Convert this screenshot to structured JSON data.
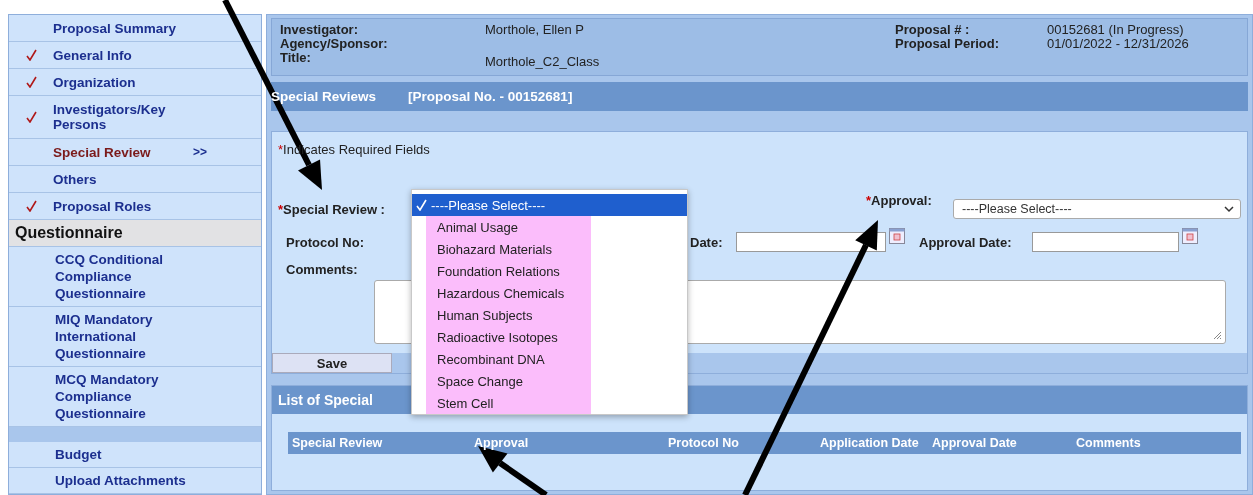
{
  "sidebar": {
    "items": [
      {
        "kind": "item",
        "label": "Proposal Summary",
        "checked": false,
        "selected": false
      },
      {
        "kind": "item",
        "label": "General Info",
        "checked": true,
        "selected": false
      },
      {
        "kind": "item",
        "label": "Organization",
        "checked": true,
        "selected": false
      },
      {
        "kind": "item",
        "label": "Investigators/Key Persons",
        "checked": true,
        "selected": false
      },
      {
        "kind": "item",
        "label": "Special Review",
        "checked": false,
        "selected": true,
        "marker": ">>"
      },
      {
        "kind": "item",
        "label": "Others",
        "checked": false,
        "selected": false
      },
      {
        "kind": "item",
        "label": "Proposal Roles",
        "checked": true,
        "selected": false
      },
      {
        "kind": "heading",
        "label": "Questionnaire"
      },
      {
        "kind": "sub",
        "label": "CCQ Conditional Compliance Questionnaire",
        "selected": false
      },
      {
        "kind": "sub",
        "label": "MIQ Mandatory International Questionnaire",
        "selected": false
      },
      {
        "kind": "sub",
        "label": "MCQ Mandatory Compliance Questionnaire",
        "selected": false
      },
      {
        "kind": "spacer"
      },
      {
        "kind": "sub",
        "label": "Budget",
        "selected": false
      },
      {
        "kind": "sub",
        "label": "Upload Attachments",
        "selected": false
      }
    ]
  },
  "header": {
    "left": [
      {
        "label": "Investigator:",
        "value": "Morthole, Ellen P"
      },
      {
        "label": "Agency/Sponsor:"
      },
      {
        "label": "Title:",
        "value": "Morthole_C2_Class"
      }
    ],
    "right": [
      {
        "label": "Proposal # :",
        "value": "00152681 (In Progress)"
      },
      {
        "label": "Proposal Period:",
        "value": "01/01/2022 - 12/31/2026"
      }
    ]
  },
  "section": {
    "title": "Special Reviews",
    "reference": "[Proposal No. - 00152681]"
  },
  "form": {
    "required_note_mark": "*",
    "required_note": "Indicates Required Fields",
    "special_review": {
      "label": "Special Review :",
      "required_mark": "*"
    },
    "approval": {
      "label": "Approval:",
      "required_mark": "*",
      "value": "----Please Select----"
    },
    "protocol_no": {
      "label": "Protocol No:"
    },
    "application_date": {
      "label": "Date:"
    },
    "approval_date": {
      "label": "Approval Date:"
    },
    "comments": {
      "label": "Comments:"
    },
    "save_button": "Save"
  },
  "dropdown": {
    "options": [
      {
        "label": "----Please Select----",
        "selected": true
      },
      {
        "label": "Animal Usage",
        "selected": false
      },
      {
        "label": "Biohazard Materials",
        "selected": false
      },
      {
        "label": "Foundation Relations",
        "selected": false
      },
      {
        "label": "Hazardous Chemicals",
        "selected": false
      },
      {
        "label": "Human Subjects",
        "selected": false
      },
      {
        "label": "Radioactive Isotopes",
        "selected": false
      },
      {
        "label": "Recombinant DNA",
        "selected": false
      },
      {
        "label": "Space Change",
        "selected": false
      },
      {
        "label": "Stem Cell",
        "selected": false
      }
    ]
  },
  "list": {
    "title": "List of Special",
    "columns": [
      "Special Review",
      "Approval",
      "Protocol No",
      "Application Date",
      "Approval Date",
      "Comments"
    ]
  }
}
